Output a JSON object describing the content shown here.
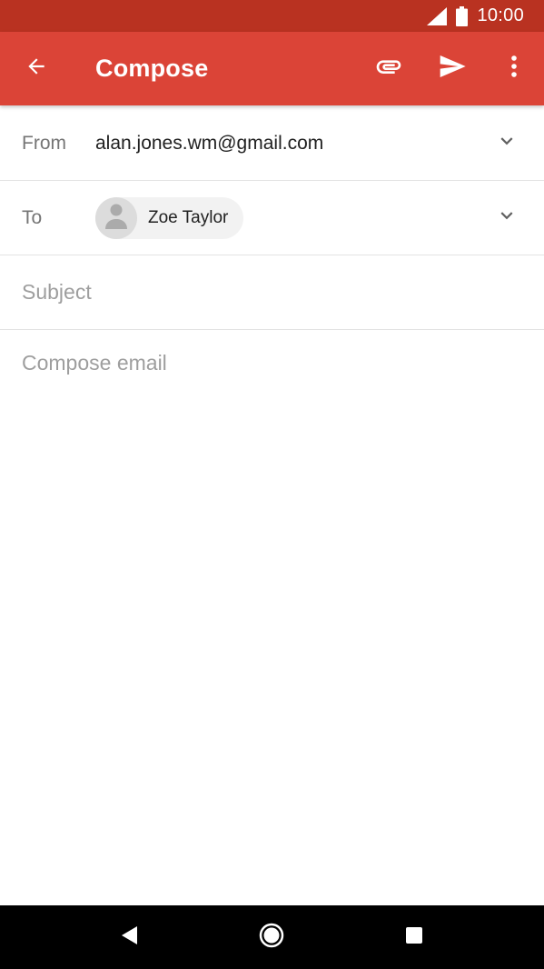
{
  "status_bar": {
    "time": "10:00",
    "icons": [
      "signal-icon",
      "battery-icon"
    ]
  },
  "app_bar": {
    "title": "Compose",
    "icons": [
      "back-arrow-icon",
      "paperclip-icon",
      "send-icon",
      "more-vert-icon"
    ],
    "background_color": "#db4437"
  },
  "compose": {
    "from_label": "From",
    "from_value": "alan.jones.wm@gmail.com",
    "to_label": "To",
    "recipients": [
      {
        "name": "Zoe Taylor"
      }
    ],
    "subject_placeholder": "Subject",
    "subject_value": "",
    "body_placeholder": "Compose email",
    "body_value": ""
  },
  "nav_bar": {
    "icons": [
      "nav-back-icon",
      "nav-home-icon",
      "nav-recents-icon"
    ]
  }
}
